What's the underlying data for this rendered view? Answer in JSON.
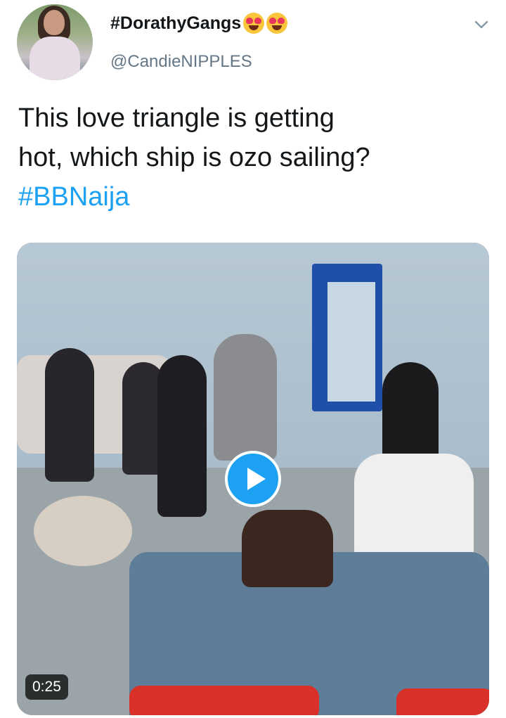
{
  "tweet": {
    "display_name": "#DorathyGangs",
    "display_name_emojis": [
      "heart-eyes-emoji",
      "heart-eyes-emoji"
    ],
    "username": "@CandieNIPPLES",
    "text_line1": "This love triangle is getting",
    "text_line2": "hot, which ship is ozo sailing?",
    "hashtag": "#BBNaija",
    "menu_icon": "chevron-down-icon"
  },
  "video": {
    "duration": "0:25",
    "play_icon": "play-icon"
  },
  "colors": {
    "text": "#14171a",
    "secondary": "#657786",
    "accent": "#1da1f2"
  }
}
